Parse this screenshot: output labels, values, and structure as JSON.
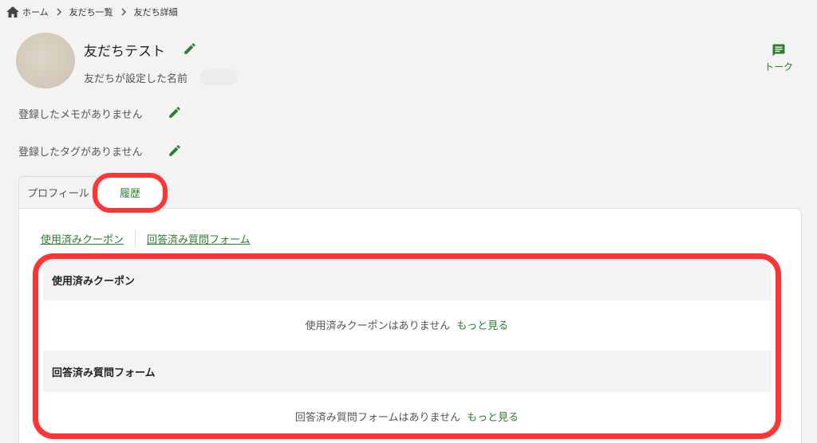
{
  "breadcrumb": {
    "home": "ホーム",
    "list": "友だち一覧",
    "current": "友だち詳細"
  },
  "friend": {
    "name": "友だちテスト",
    "display_name_label": "友だちが設定した名前"
  },
  "talk_button": {
    "label": "トーク"
  },
  "memo": {
    "text": "登録したメモがありません"
  },
  "tags": {
    "text": "登録したタグがありません"
  },
  "tabs": [
    {
      "label": "プロフィール",
      "active": false
    },
    {
      "label": "履歴",
      "active": true
    }
  ],
  "sublinks": {
    "coupons": "使用済みクーポン",
    "forms": "回答済み質問フォーム"
  },
  "sections": {
    "coupons": {
      "title": "使用済みクーポン",
      "empty": "使用済みクーポンはありません",
      "more": "もっと見る"
    },
    "forms": {
      "title": "回答済み質問フォーム",
      "empty": "回答済み質問フォームはありません",
      "more": "もっと見る"
    }
  },
  "colors": {
    "accent": "#2e7d32",
    "highlight": "#ff3434",
    "background": "#f3f3f3"
  }
}
